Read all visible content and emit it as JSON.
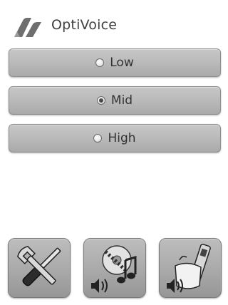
{
  "app": {
    "title": "OptiVoice"
  },
  "options": [
    {
      "label": "Low",
      "selected": false
    },
    {
      "label": "Mid",
      "selected": true
    },
    {
      "label": "High",
      "selected": false
    }
  ],
  "toolbar": {
    "buttons": [
      {
        "icon": "tools-icon"
      },
      {
        "icon": "media-audio-icon"
      },
      {
        "icon": "phone-audio-icon"
      }
    ]
  },
  "colors": {
    "button_face": "#b8b8b8",
    "text": "#333333",
    "logo": "#6e6e6e"
  }
}
